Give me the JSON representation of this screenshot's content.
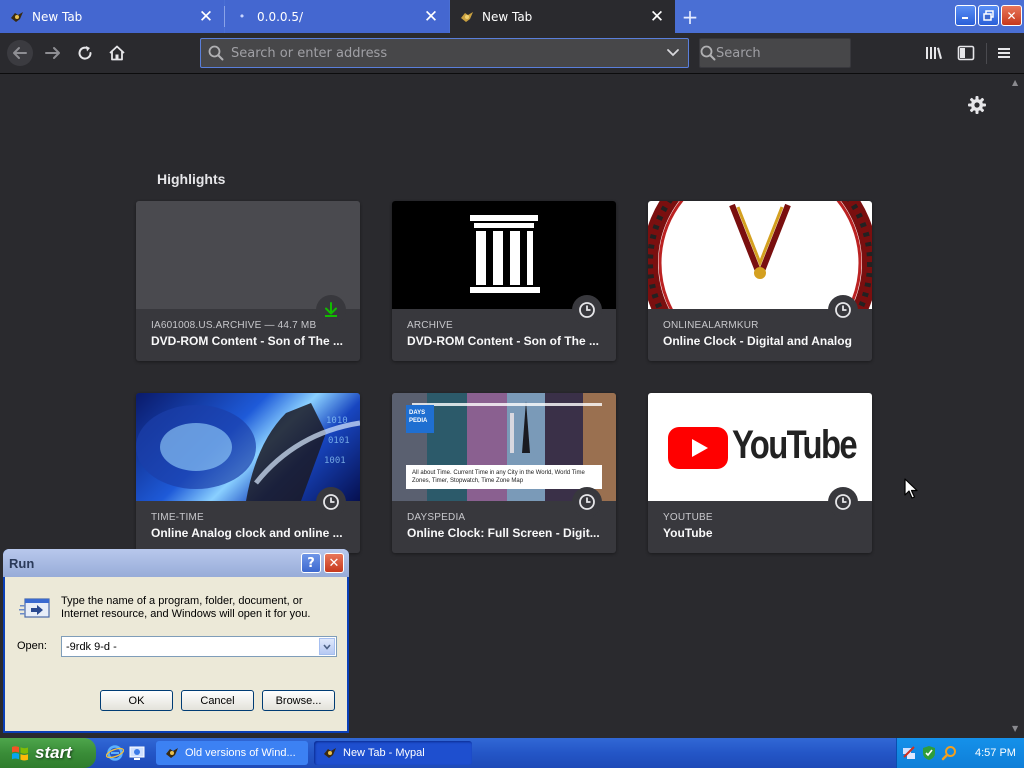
{
  "browser": {
    "tabs": [
      {
        "title": "New Tab",
        "active": false
      },
      {
        "title": "0.0.0.5/",
        "active": false
      },
      {
        "title": "New Tab",
        "active": true
      }
    ],
    "address_placeholder": "Search or enter address",
    "search_placeholder": "Search"
  },
  "newtab": {
    "section_title": "Highlights",
    "cards": [
      {
        "host": "IA601008.US.ARCHIVE — 44.7 MB",
        "title": "DVD-ROM Content - Son of The ...",
        "badge": "download-icon"
      },
      {
        "host": "ARCHIVE",
        "title": "DVD-ROM Content - Son of The ...",
        "badge": "clock-icon"
      },
      {
        "host": "ONLINEALARMKUR",
        "title": "Online Clock - Digital and Analog",
        "badge": "clock-icon"
      },
      {
        "host": "TIME-TIME",
        "title": "Online Analog clock and online ...",
        "badge": "clock-icon"
      },
      {
        "host": "DAYSPEDIA",
        "title": "Online Clock: Full Screen - Digit...",
        "badge": "clock-icon"
      },
      {
        "host": "YOUTUBE",
        "title": "YouTube",
        "badge": "clock-icon"
      }
    ],
    "dayspedia_thumb": {
      "logo_top": "DAYS",
      "logo_bottom": "PEDIA",
      "caption": "All about Time. Current Time in any City in the World, World Time Zones, Timer, Stopwatch, Time Zone Map"
    },
    "youtube_thumb_text": "YouTube"
  },
  "run_dialog": {
    "title": "Run",
    "help_label": "?",
    "description": "Type the name of a program, folder, document, or Internet resource, and Windows will open it for you.",
    "open_label": "Open:",
    "open_value": "-9rdk 9-d -",
    "ok": "OK",
    "cancel": "Cancel",
    "browse": "Browse..."
  },
  "taskbar": {
    "start": "start",
    "buttons": [
      {
        "label": "Old versions of Wind..."
      },
      {
        "label": "New Tab - Mypal"
      }
    ],
    "clock": "4:57 PM"
  },
  "colors": {
    "page_bg": "#2a2a2e",
    "card_bg": "#38383d",
    "xp_blue": "#2456c7",
    "start_green": "#3a8d38",
    "youtube_red": "#ff0000",
    "download_green": "#12bc00"
  }
}
